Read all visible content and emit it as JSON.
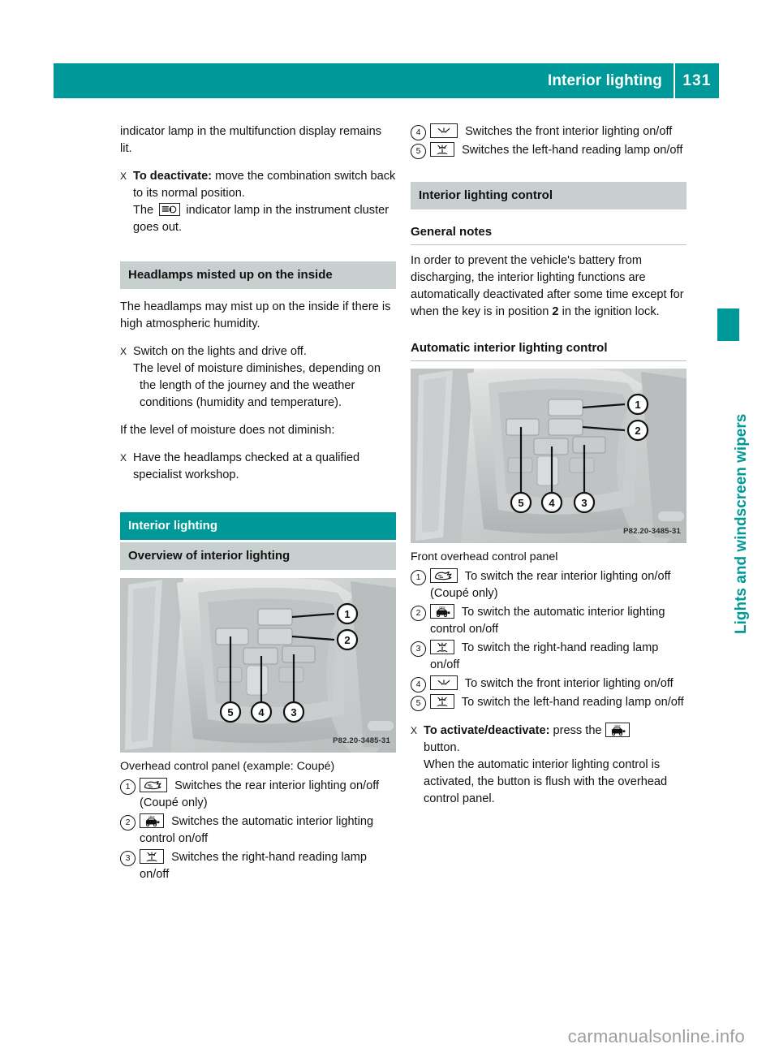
{
  "header": {
    "title": "Interior lighting",
    "page_number": "131",
    "accent_color": "#009999"
  },
  "side_tab": {
    "label": "Lights and windscreen wipers",
    "color": "#009999"
  },
  "watermark": "carmanualsonline.info",
  "left_column": {
    "continued_paragraph": "indicator lamp in the multifunction display remains lit.",
    "deactivate_step": {
      "marker": "X",
      "bold_lead": "To deactivate:",
      "text": " move the combination switch back to its normal position.",
      "line2_before": "The",
      "icon": "fog-lamp-indicator-icon",
      "line2_after": "indicator lamp in the instrument cluster goes out."
    },
    "section_headlamps": {
      "heading": "Headlamps misted up on the inside",
      "intro": "The headlamps may mist up on the inside if there is high atmospheric humidity.",
      "step1": {
        "marker": "X",
        "text": "Switch on the lights and drive off.",
        "sub": "The level of moisture diminishes, depending on the length of the journey and the weather conditions (humidity and temperature)."
      },
      "mid_text": "If the level of moisture does not diminish:",
      "step2": {
        "marker": "X",
        "text": "Have the headlamps checked at a qualified specialist workshop."
      }
    },
    "section_interior": {
      "teal_heading": "Interior lighting",
      "grey_heading": "Overview of interior lighting",
      "figure_code": "P82.20-3485-31",
      "figure_caption": "Overhead control panel (example: Coupé)",
      "items": [
        {
          "num": "1",
          "icon": "rear-interior-lighting-icon",
          "text": "Switches the rear interior lighting on/off (Coupé only)"
        },
        {
          "num": "2",
          "icon": "automatic-interior-lighting-icon",
          "text": "Switches the automatic interior lighting control on/off"
        },
        {
          "num": "3",
          "icon": "reading-lamp-icon",
          "text": "Switches the right-hand reading lamp on/off"
        }
      ]
    }
  },
  "right_column": {
    "continued_items": [
      {
        "num": "4",
        "icon": "front-interior-lighting-icon",
        "text": "Switches the front interior lighting on/off"
      },
      {
        "num": "5",
        "icon": "reading-lamp-icon",
        "text": "Switches the left-hand reading lamp on/off"
      }
    ],
    "section_control": {
      "grey_heading": "Interior lighting control",
      "general_notes_heading": "General notes",
      "general_notes_text_1": "In order to prevent the vehicle's battery from discharging, the interior lighting functions are automatically deactivated after some time except for when the key is in position ",
      "general_notes_bold": "2",
      "general_notes_text_2": " in the ignition lock.",
      "auto_heading": "Automatic interior lighting control",
      "figure_code": "P82.20-3485-31",
      "figure_caption": "Front overhead control panel",
      "items": [
        {
          "num": "1",
          "icon": "rear-interior-lighting-icon",
          "text": "To switch the rear interior lighting on/off (Coupé only)"
        },
        {
          "num": "2",
          "icon": "automatic-interior-lighting-icon",
          "text": "To switch the automatic interior lighting control on/off"
        },
        {
          "num": "3",
          "icon": "reading-lamp-icon",
          "text": "To switch the right-hand reading lamp on/off"
        },
        {
          "num": "4",
          "icon": "front-interior-lighting-icon",
          "text": "To switch the front interior lighting on/off"
        },
        {
          "num": "5",
          "icon": "reading-lamp-icon",
          "text": "To switch the left-hand reading lamp on/off"
        }
      ],
      "activate_step": {
        "marker": "X",
        "bold_lead": "To activate/deactivate:",
        "text_before": " press the ",
        "icon": "automatic-interior-lighting-icon",
        "text_after": "button.",
        "followup": "When the automatic interior lighting control is activated, the button is flush with the overhead control panel."
      }
    }
  }
}
